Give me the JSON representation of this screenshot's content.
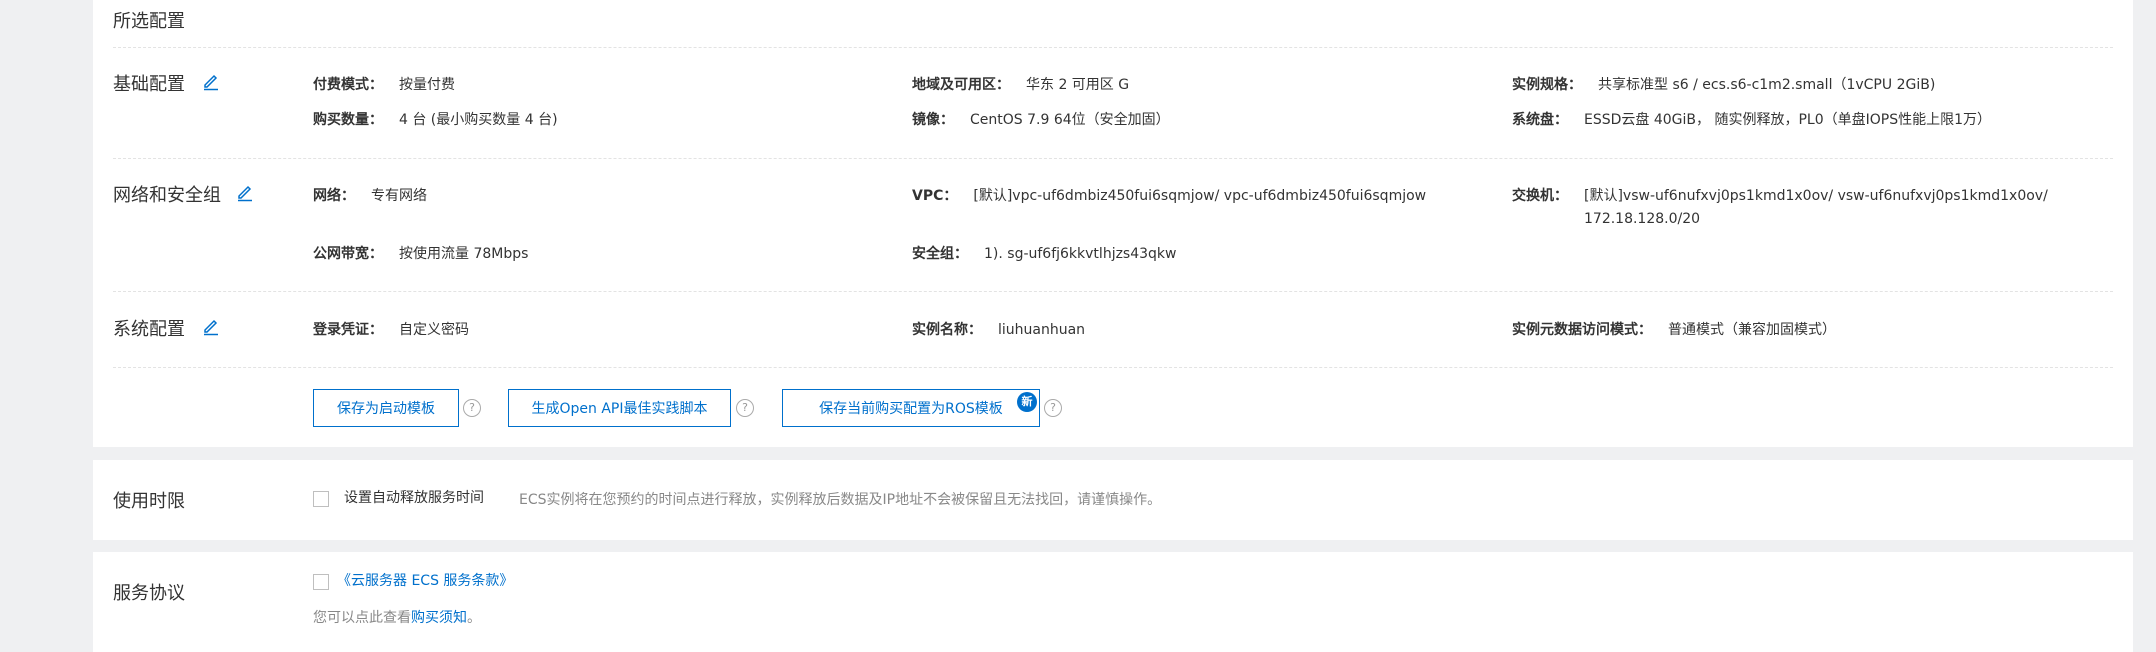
{
  "selected_config": {
    "title": "所选配置",
    "sections": {
      "basic": {
        "title": "基础配置",
        "billing_mode": {
          "label": "付费模式：",
          "value": "按量付费"
        },
        "quantity": {
          "label": "购买数量：",
          "value": "4 台 (最小购买数量 4 台)"
        },
        "region": {
          "label": "地域及可用区：",
          "value": "华东 2 可用区 G"
        },
        "image": {
          "label": "镜像：",
          "value": "CentOS 7.9 64位（安全加固）"
        },
        "instance_type": {
          "label": "实例规格：",
          "value": "共享标准型 s6 / ecs.s6-c1m2.small（1vCPU 2GiB)"
        },
        "system_disk": {
          "label": "系统盘：",
          "value": "ESSD云盘 40GiB， 随实例释放，PL0（单盘IOPS性能上限1万）"
        }
      },
      "network": {
        "title": "网络和安全组",
        "network": {
          "label": "网络：",
          "value": "专有网络"
        },
        "bandwidth": {
          "label": "公网带宽：",
          "value": "按使用流量 78Mbps"
        },
        "vpc": {
          "label": "VPC：",
          "value": "[默认]vpc-uf6dmbiz450fui6sqmjow/ vpc-uf6dmbiz450fui6sqmjow"
        },
        "security_group": {
          "label": "安全组：",
          "value": "1). sg-uf6fj6kkvtlhjzs43qkw"
        },
        "vswitch": {
          "label": "交换机：",
          "value_line1": "[默认]vsw-uf6nufxvj0ps1kmd1x0ov/ vsw-uf6nufxvj0ps1kmd1x0ov/",
          "value_line2": "172.18.128.0/20"
        }
      },
      "system": {
        "title": "系统配置",
        "login": {
          "label": "登录凭证：",
          "value": "自定义密码"
        },
        "instance_name": {
          "label": "实例名称：",
          "value": "liuhuanhuan"
        },
        "metadata_mode": {
          "label": "实例元数据访问模式：",
          "value": "普通模式（兼容加固模式）"
        }
      }
    },
    "buttons": {
      "save_template": "保存为启动模板",
      "gen_api": "生成Open API最佳实践脚本",
      "save_ros": "保存当前购买配置为ROS模板",
      "new_badge": "新",
      "help": "?"
    }
  },
  "duration": {
    "title": "使用时限",
    "checkbox_label": "设置自动释放服务时间",
    "hint": "ECS实例将在您预约的时间点进行释放，实例释放后数据及IP地址不会被保留且无法找回，请谨慎操作。"
  },
  "agreement": {
    "title": "服务协议",
    "terms_link": "《云服务器 ECS 服务条款》",
    "notice_prefix": "您可以点此查看",
    "notice_link": "购买须知",
    "notice_suffix": "。"
  },
  "colors": {
    "accent": "#0070cc",
    "background": "#eff0f2",
    "card": "#ffffff"
  },
  "icons": {
    "edit": "edit-icon",
    "help": "question-circle-icon"
  }
}
